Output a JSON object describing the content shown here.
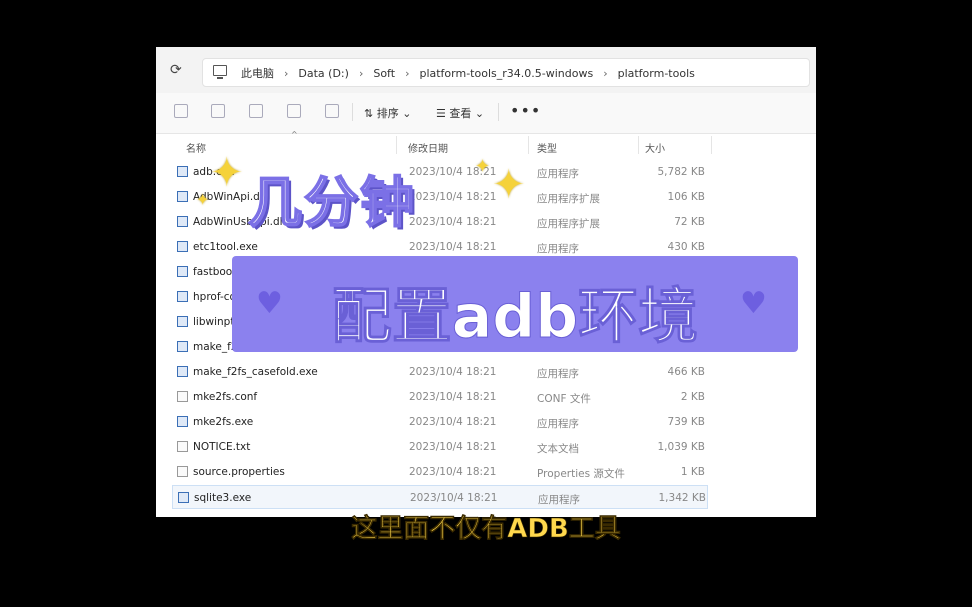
{
  "address_bar": {
    "breadcrumbs": [
      "此电脑",
      "Data (D:)",
      "Soft",
      "platform-tools_r34.0.5-windows",
      "platform-tools"
    ]
  },
  "toolbar": {
    "sort_label": "排序",
    "view_label": "查看",
    "more_label": "•••"
  },
  "columns": {
    "name": "名称",
    "date": "修改日期",
    "type": "类型",
    "size": "大小"
  },
  "files": [
    {
      "name": "adb.exe",
      "date": "2023/10/4 18:21",
      "type": "应用程序",
      "size": "5,782 KB",
      "icon": "exe-icon"
    },
    {
      "name": "AdbWinApi.dll",
      "date": "2023/10/4 18:21",
      "type": "应用程序扩展",
      "size": "106 KB",
      "icon": "dll-icon"
    },
    {
      "name": "AdbWinUsbApi.dll",
      "date": "2023/10/4 18:21",
      "type": "应用程序扩展",
      "size": "72 KB",
      "icon": "dll-icon"
    },
    {
      "name": "etc1tool.exe",
      "date": "2023/10/4 18:21",
      "type": "应用程序",
      "size": "430 KB",
      "icon": "exe-icon"
    },
    {
      "name": "fastboot.exe",
      "date": "",
      "type": "",
      "size": "",
      "icon": "exe-icon"
    },
    {
      "name": "hprof-conv.exe",
      "date": "",
      "type": "",
      "size": "",
      "icon": "exe-icon"
    },
    {
      "name": "libwinpthread-1.dll",
      "date": "",
      "type": "",
      "size": "",
      "icon": "dll-icon"
    },
    {
      "name": "make_f2fs.exe",
      "date": "",
      "type": "",
      "size": "",
      "icon": "exe-icon"
    },
    {
      "name": "make_f2fs_casefold.exe",
      "date": "2023/10/4 18:21",
      "type": "应用程序",
      "size": "466 KB",
      "icon": "exe-icon"
    },
    {
      "name": "mke2fs.conf",
      "date": "2023/10/4 18:21",
      "type": "CONF 文件",
      "size": "2 KB",
      "icon": "file-icon"
    },
    {
      "name": "mke2fs.exe",
      "date": "2023/10/4 18:21",
      "type": "应用程序",
      "size": "739 KB",
      "icon": "exe-icon"
    },
    {
      "name": "NOTICE.txt",
      "date": "2023/10/4 18:21",
      "type": "文本文档",
      "size": "1,039 KB",
      "icon": "text-file-icon"
    },
    {
      "name": "source.properties",
      "date": "2023/10/4 18:21",
      "type": "Properties 源文件",
      "size": "1 KB",
      "icon": "file-icon"
    },
    {
      "name": "sqlite3.exe",
      "date": "2023/10/4 18:21",
      "type": "应用程序",
      "size": "1,342 KB",
      "icon": "exe-icon"
    }
  ],
  "overlay": {
    "title_top": "几分钟",
    "title_banner": "配置adb环境",
    "subtitle": "这里面不仅有ADB工具",
    "banner_color": "#8b81ee",
    "subtitle_color": "#ffd84d"
  }
}
